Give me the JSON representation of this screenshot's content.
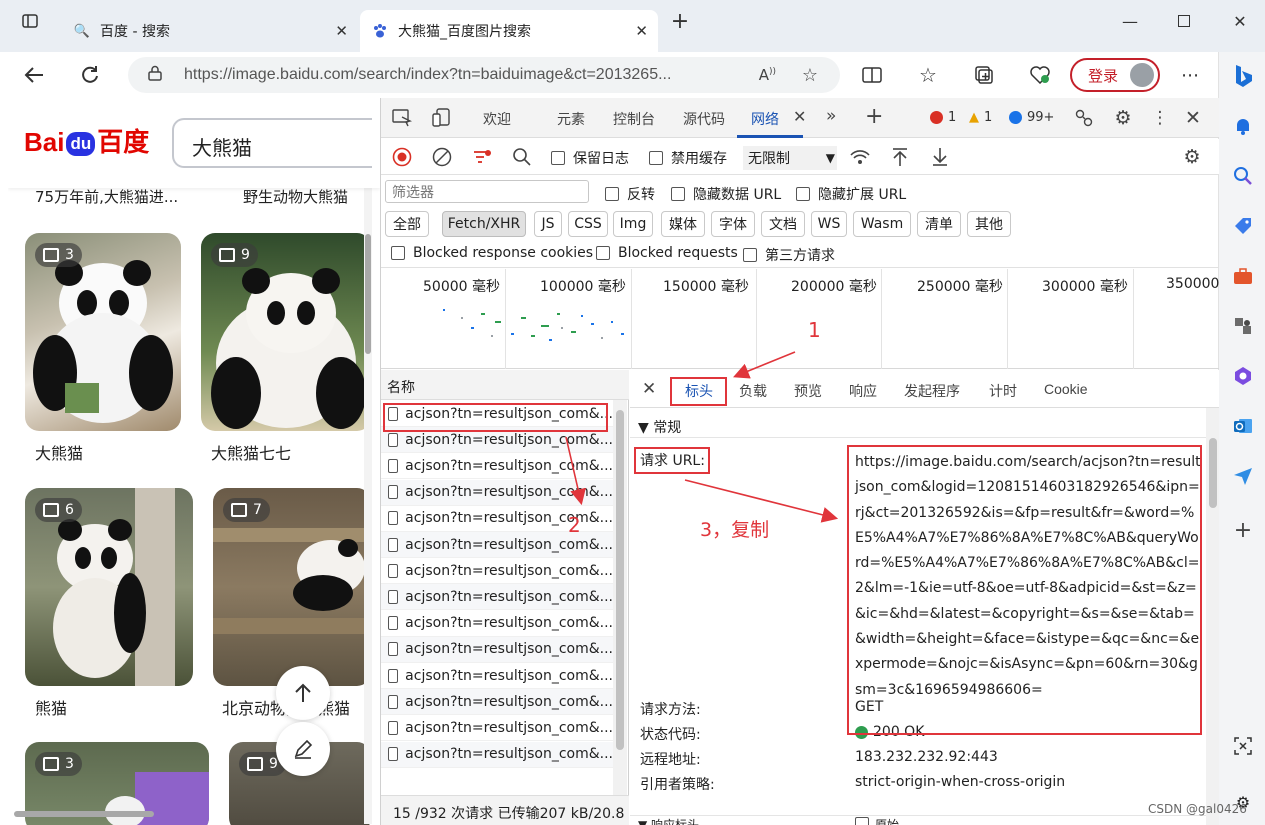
{
  "browser": {
    "tabs": [
      {
        "title": "百度 - 搜索",
        "active": false
      },
      {
        "title": "大熊猫_百度图片搜索",
        "active": true
      }
    ],
    "new_tab_icon": "plus-icon",
    "address": "https://image.baidu.com/search/index?tn=baiduimage&ct=2013265...",
    "login_label": "登录"
  },
  "page": {
    "logo_text": "Bai",
    "logo_du": "du",
    "logo_tail": "百度",
    "search_value": "大熊猫",
    "top_captions": [
      "75万年前,大熊猫进...",
      "野生动物大熊猫"
    ],
    "images": [
      {
        "count": "3",
        "label": "大熊猫"
      },
      {
        "count": "9",
        "label": "大熊猫七七"
      },
      {
        "count": "6",
        "label": "熊猫"
      },
      {
        "count": "7",
        "label": "北京动物园大熊猫"
      },
      {
        "count": "3",
        "label": ""
      },
      {
        "count": "9",
        "label": ""
      }
    ]
  },
  "devtools": {
    "tabs": [
      "欢迎",
      "元素",
      "控制台",
      "源代码",
      "网络"
    ],
    "errors": "1",
    "warnings": "1",
    "messages": "99+",
    "toolbar": {
      "preserve_log": "保留日志",
      "disable_cache": "禁用缓存",
      "throttle": "无限制"
    },
    "filter": {
      "placeholder": "筛选器",
      "invert": "反转",
      "hide_data_url": "隐藏数据 URL",
      "hide_ext_url": "隐藏扩展 URL"
    },
    "types": [
      "全部",
      "Fetch/XHR",
      "JS",
      "CSS",
      "Img",
      "媒体",
      "字体",
      "文档",
      "WS",
      "Wasm",
      "清单",
      "其他"
    ],
    "blocked": {
      "blocked_cookies": "Blocked response cookies",
      "blocked_requests": "Blocked requests",
      "third_party": "第三方请求"
    },
    "overview_ticks": [
      "50000 毫秒",
      "100000 毫秒",
      "150000 毫秒",
      "200000 毫秒",
      "250000 毫秒",
      "300000 毫秒",
      "350000"
    ],
    "requests": {
      "header": "名称",
      "items": [
        "acjson?tn=resultjson_com&...",
        "acjson?tn=resultjson_com&...",
        "acjson?tn=resultjson_com&...",
        "acjson?tn=resultjson_com&...",
        "acjson?tn=resultjson_com&...",
        "acjson?tn=resultjson_com&...",
        "acjson?tn=resultjson_com&...",
        "acjson?tn=resultjson_com&...",
        "acjson?tn=resultjson_com&...",
        "acjson?tn=resultjson_com&...",
        "acjson?tn=resultjson_com&...",
        "acjson?tn=resultjson_com&...",
        "acjson?tn=resultjson_com&...",
        "acjson?tn=resultjson_com&..."
      ],
      "status": "15 /932 次请求 已传输207 kB/20.8"
    },
    "detail": {
      "tabs": [
        "标头",
        "负载",
        "预览",
        "响应",
        "发起程序",
        "计时",
        "Cookie"
      ],
      "general": "▼ 常规",
      "request_url_key": "请求 URL:",
      "request_url": "https://image.baidu.com/search/acjson?tn=resultjson_com&logid=12081514603182926546&ipn=rj&ct=201326592&is=&fp=result&fr=&word=%E5%A4%A7%E7%86%8A%E7%8C%AB&queryWord=%E5%A4%A7%E7%86%8A%E7%8C%AB&cl=2&lm=-1&ie=utf-8&oe=utf-8&adpicid=&st=&z=&ic=&hd=&latest=&copyright=&s=&se=&tab=&width=&height=&face=&istype=&qc=&nc=&expermode=&nojc=&isAsync=&pn=60&rn=30&gsm=3c&1696594986606=",
      "method_key": "请求方法:",
      "method": "GET",
      "status_key": "状态代码:",
      "status": "200 OK",
      "remote_key": "远程地址:",
      "remote": "183.232.232.92:443",
      "referrer_key": "引用者策略:",
      "referrer": "strict-origin-when-cross-origin",
      "response_headers": "▼ 响应标头",
      "raw": "原始"
    }
  },
  "annotations": {
    "label_1": "1",
    "label_2": "2",
    "label_3": "3，复制"
  },
  "watermark": "CSDN @gal0426",
  "colors": {
    "annotation_red": "#e0353b",
    "devtools_accent": "#1a53b3",
    "baidu_red": "#e10601",
    "baidu_blue": "#2932e1"
  }
}
